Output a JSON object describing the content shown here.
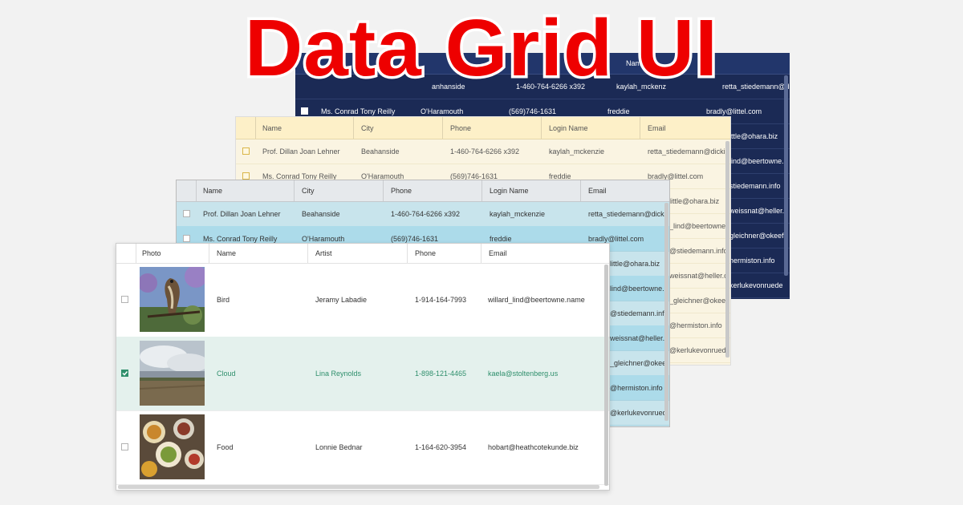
{
  "title": "Data Grid UI",
  "grids": {
    "navy": {
      "headers": [
        "Name"
      ],
      "rows": [
        {
          "name": "",
          "city": "anhanside",
          "phone": "1-460-764-6266 x392",
          "login": "kaylah_mckenz",
          "email": "retta_stiedemann@dicki."
        },
        {
          "name": "Ms. Conrad Tony Reilly",
          "city": "O'Haramouth",
          "phone": "(569)746-1631",
          "login": "freddie",
          "email": "bradly@littel.com"
        },
        {
          "email": "ittle@ohara.biz"
        },
        {
          "email": "lind@beertowne.r"
        },
        {
          "email": "stiedemann.info"
        },
        {
          "email": "weissnat@heller.c"
        },
        {
          "email": "gleichner@okeef"
        },
        {
          "email": "hermiston.info"
        },
        {
          "email": "kerlukevonruede"
        }
      ]
    },
    "yellow": {
      "headers": [
        "Name",
        "City",
        "Phone",
        "Login Name",
        "Email"
      ],
      "rows": [
        {
          "name": "Prof. Dillan Joan Lehner",
          "city": "Beahanside",
          "phone": "1-460-764-6266 x392",
          "login": "kaylah_mckenzie",
          "email": "retta_stiedemann@dicki."
        },
        {
          "name": "Ms. Conrad Tony Reilly",
          "city": "O'Haramouth",
          "phone": "(569)746-1631",
          "login": "freddie",
          "email": "bradly@littel.com"
        },
        {
          "email": "little@ohara.biz"
        },
        {
          "email": "_lind@beertowne.r"
        },
        {
          "email": "@stiedemann.info"
        },
        {
          "email": "weissnat@heller.c"
        },
        {
          "email": "_gleichner@okeef"
        },
        {
          "email": "@hermiston.info"
        },
        {
          "email": "@kerlukevonruede"
        }
      ]
    },
    "blue": {
      "headers": [
        "Name",
        "City",
        "Phone",
        "Login Name",
        "Email"
      ],
      "rows": [
        {
          "name": "Prof. Dillan Joan Lehner",
          "city": "Beahanside",
          "phone": "1-460-764-6266 x392",
          "login": "kaylah_mckenzie",
          "email": "retta_stiedemann@dicki."
        },
        {
          "name": "Ms. Conrad Tony Reilly",
          "city": "O'Haramouth",
          "phone": "(569)746-1631",
          "login": "freddie",
          "email": "bradly@littel.com"
        },
        {
          "email": "little@ohara.biz"
        },
        {
          "email": "lind@beertowne.r"
        },
        {
          "email": "@stiedemann.info"
        },
        {
          "email": "weissnat@heller.c"
        },
        {
          "email": "_gleichner@okeef"
        },
        {
          "email": "@hermiston.info"
        },
        {
          "email": "@kerlukevonruede"
        }
      ]
    },
    "front": {
      "headers": [
        "Photo",
        "Name",
        "Artist",
        "Phone",
        "Email"
      ],
      "rows": [
        {
          "photo": "bird-photo",
          "name": "Bird",
          "artist": "Jeramy Labadie",
          "phone": "1-914-164-7993",
          "email": "willard_lind@beertowne.name",
          "selected": false
        },
        {
          "photo": "cloud-photo",
          "name": "Cloud",
          "artist": "Lina Reynolds",
          "phone": "1-898-121-4465",
          "email": "kaela@stoltenberg.us",
          "selected": true
        },
        {
          "photo": "food-photo",
          "name": "Food",
          "artist": "Lonnie Bednar",
          "phone": "1-164-620-3954",
          "email": "hobart@heathcotekunde.biz",
          "selected": false
        }
      ]
    }
  },
  "colors": {
    "title": "#ee0000",
    "navy": "#1b2a55",
    "yellow": "#faf4e2",
    "blue": "#c8e4ec",
    "selected_row": "#e4f1ed",
    "selected_text": "#2f8f6c",
    "checkbox_checked": "#2f8f6c"
  }
}
